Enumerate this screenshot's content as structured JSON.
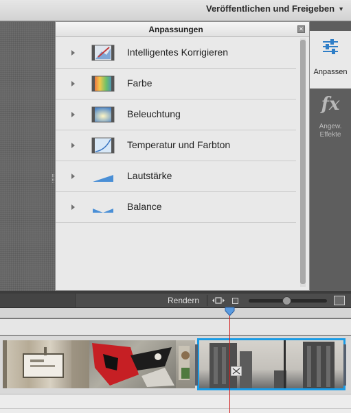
{
  "header": {
    "publish_label": "Veröffentlichen und Freigeben"
  },
  "panel": {
    "title": "Anpassungen",
    "items": [
      {
        "label": "Intelligentes Korrigieren",
        "icon": "smart-fix-icon"
      },
      {
        "label": "Farbe",
        "icon": "color-icon"
      },
      {
        "label": "Beleuchtung",
        "icon": "lighting-icon"
      },
      {
        "label": "Temperatur und Farbton",
        "icon": "temperature-tint-icon"
      },
      {
        "label": "Lautstärke",
        "icon": "volume-icon"
      },
      {
        "label": "Balance",
        "icon": "balance-icon"
      }
    ]
  },
  "tabs": {
    "adjust_label": "Anpassen",
    "fx_glyph": "fx",
    "effects_line1": "Angew.",
    "effects_line2": "Effekte"
  },
  "timeline": {
    "render_label": "Rendern",
    "zoom_level": 0.48
  },
  "colors": {
    "selection": "#1a9ce6",
    "playhead": "#d11b1b",
    "icon_blue": "#4a8fd6"
  }
}
